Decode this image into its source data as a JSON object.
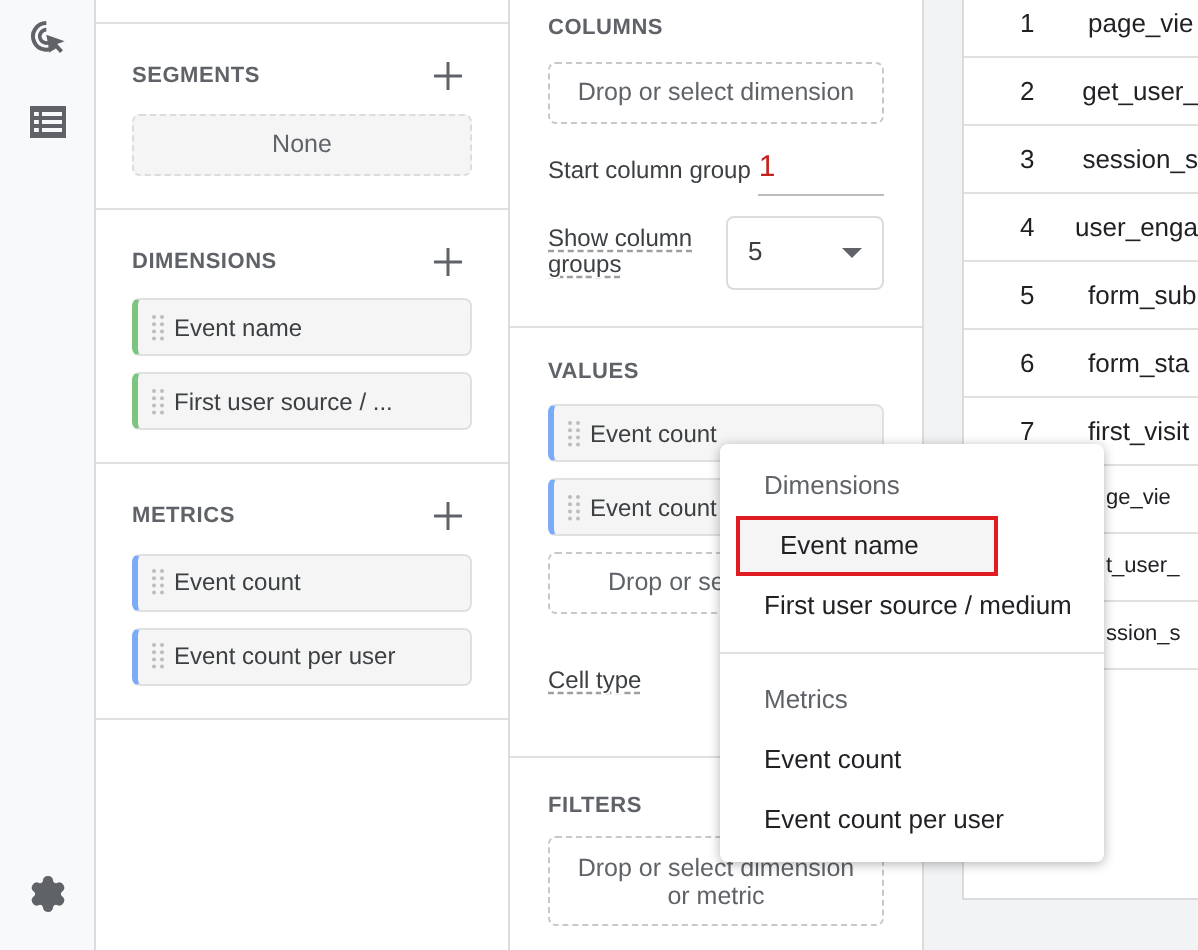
{
  "left_panel": {
    "sections": [
      {
        "title": "SEGMENTS",
        "items": [
          {
            "label": "None",
            "kind": "empty"
          }
        ]
      },
      {
        "title": "DIMENSIONS",
        "items": [
          {
            "label": "Event name",
            "kind": "dimension"
          },
          {
            "label": "First user source / ...",
            "kind": "dimension"
          }
        ]
      },
      {
        "title": "METRICS",
        "items": [
          {
            "label": "Event count",
            "kind": "metric"
          },
          {
            "label": "Event count per user",
            "kind": "metric"
          }
        ]
      }
    ]
  },
  "settings": {
    "columns": {
      "title": "COLUMNS",
      "drop_zone": "Drop or select dimension",
      "start_column_group": {
        "label": "Start column group",
        "value": "1"
      },
      "show_column_groups": {
        "label": "Show column groups",
        "value": "5"
      }
    },
    "values": {
      "title": "VALUES",
      "chips": [
        {
          "label": "Event count",
          "kind": "metric"
        },
        {
          "label": "Event count",
          "kind": "metric"
        }
      ],
      "drop_zone": "Drop or se",
      "cell_type": {
        "label": "Cell type"
      }
    },
    "filters": {
      "title": "FILTERS",
      "drop_zone": "Drop or select dimension or metric"
    }
  },
  "table": {
    "rows": [
      {
        "number": "1",
        "event": "page_vie"
      },
      {
        "number": "2",
        "event": "get_user_"
      },
      {
        "number": "3",
        "event": "session_s"
      },
      {
        "number": "4",
        "event": "user_enga"
      },
      {
        "number": "5",
        "event": "form_sub"
      },
      {
        "number": "6",
        "event": "form_sta"
      },
      {
        "number": "7",
        "event": "first_visit"
      },
      {
        "event": "ge_vie"
      },
      {
        "event": "t_user_"
      },
      {
        "event": "ssion_s"
      }
    ]
  },
  "menu": {
    "sections": [
      {
        "header": "Dimensions",
        "items": [
          {
            "label": "Event name",
            "selected": true
          },
          {
            "label": "First user source / medium",
            "selected": false
          }
        ]
      },
      {
        "header": "Metrics",
        "items": [
          {
            "label": "Event count",
            "selected": false
          },
          {
            "label": "Event count per user",
            "selected": false
          }
        ]
      }
    ]
  }
}
